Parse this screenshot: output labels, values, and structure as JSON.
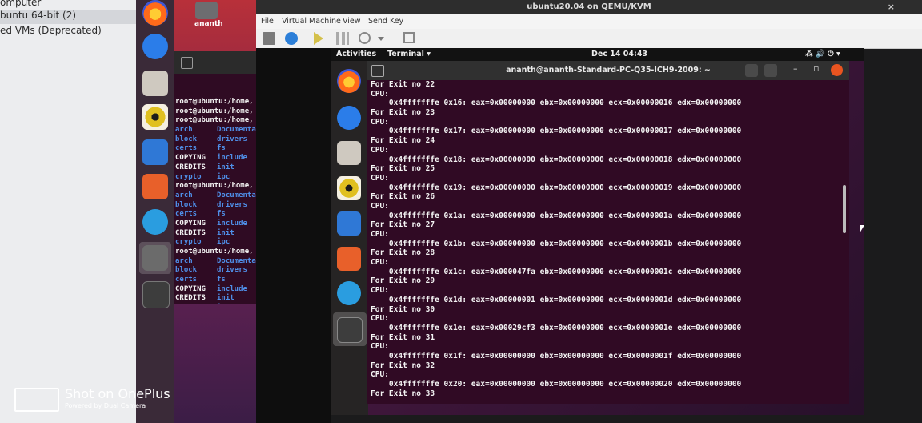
{
  "host_vmlist": {
    "items": [
      "omputer",
      "buntu 64-bit (2)",
      "ed VMs (Deprecated)"
    ],
    "selected_index": 1
  },
  "host_desktop": {
    "home_label": "ananth"
  },
  "host_terminal": {
    "prompt": "root@ubuntu:/home,",
    "dir_rows": [
      [
        "arch",
        "Documenta"
      ],
      [
        "block",
        "drivers"
      ],
      [
        "certs",
        "fs"
      ],
      [
        "COPYING",
        "include"
      ],
      [
        "CREDITS",
        "init"
      ],
      [
        "crypto",
        "ipc"
      ]
    ]
  },
  "qemu": {
    "title": "ubuntu20.04 on QEMU/KVM",
    "close": "×",
    "menu": [
      "File",
      "Virtual Machine",
      "View",
      "Send Key"
    ]
  },
  "guest_topbar": {
    "activities": "Activities",
    "app": "Terminal ▾",
    "clock": "Dec 14  04:43",
    "tray": "⁂  🔊  ⏻  ▾"
  },
  "guest_terminal": {
    "title": "ananth@ananth-Standard-PC-Q35-ICH9-2009: ~",
    "lines": [
      "For Exit no 22",
      "CPU:",
      "    0x4fffffffe 0x16: eax=0x00000000 ebx=0x00000000 ecx=0x00000016 edx=0x00000000",
      "For Exit no 23",
      "CPU:",
      "    0x4fffffffe 0x17: eax=0x00000000 ebx=0x00000000 ecx=0x00000017 edx=0x00000000",
      "For Exit no 24",
      "CPU:",
      "    0x4fffffffe 0x18: eax=0x00000000 ebx=0x00000000 ecx=0x00000018 edx=0x00000000",
      "For Exit no 25",
      "CPU:",
      "    0x4fffffffe 0x19: eax=0x00000000 ebx=0x00000000 ecx=0x00000019 edx=0x00000000",
      "For Exit no 26",
      "CPU:",
      "    0x4fffffffe 0x1a: eax=0x00000000 ebx=0x00000000 ecx=0x0000001a edx=0x00000000",
      "For Exit no 27",
      "CPU:",
      "    0x4fffffffe 0x1b: eax=0x00000000 ebx=0x00000000 ecx=0x0000001b edx=0x00000000",
      "For Exit no 28",
      "CPU:",
      "    0x4fffffffe 0x1c: eax=0x000047fa ebx=0x00000000 ecx=0x0000001c edx=0x00000000",
      "For Exit no 29",
      "CPU:",
      "    0x4fffffffe 0x1d: eax=0x00000001 ebx=0x00000000 ecx=0x0000001d edx=0x00000000",
      "For Exit no 30",
      "CPU:",
      "    0x4fffffffe 0x1e: eax=0x00029cf3 ebx=0x00000000 ecx=0x0000001e edx=0x00000000",
      "For Exit no 31",
      "CPU:",
      "    0x4fffffffe 0x1f: eax=0x00000000 ebx=0x00000000 ecx=0x0000001f edx=0x00000000",
      "For Exit no 32",
      "CPU:",
      "    0x4fffffffe 0x20: eax=0x00000000 ebx=0x00000000 ecx=0x00000020 edx=0x00000000",
      "For Exit no 33"
    ]
  },
  "watermark": {
    "main": "Shot on OnePlus",
    "sub": "Powered by Dual Camera"
  }
}
